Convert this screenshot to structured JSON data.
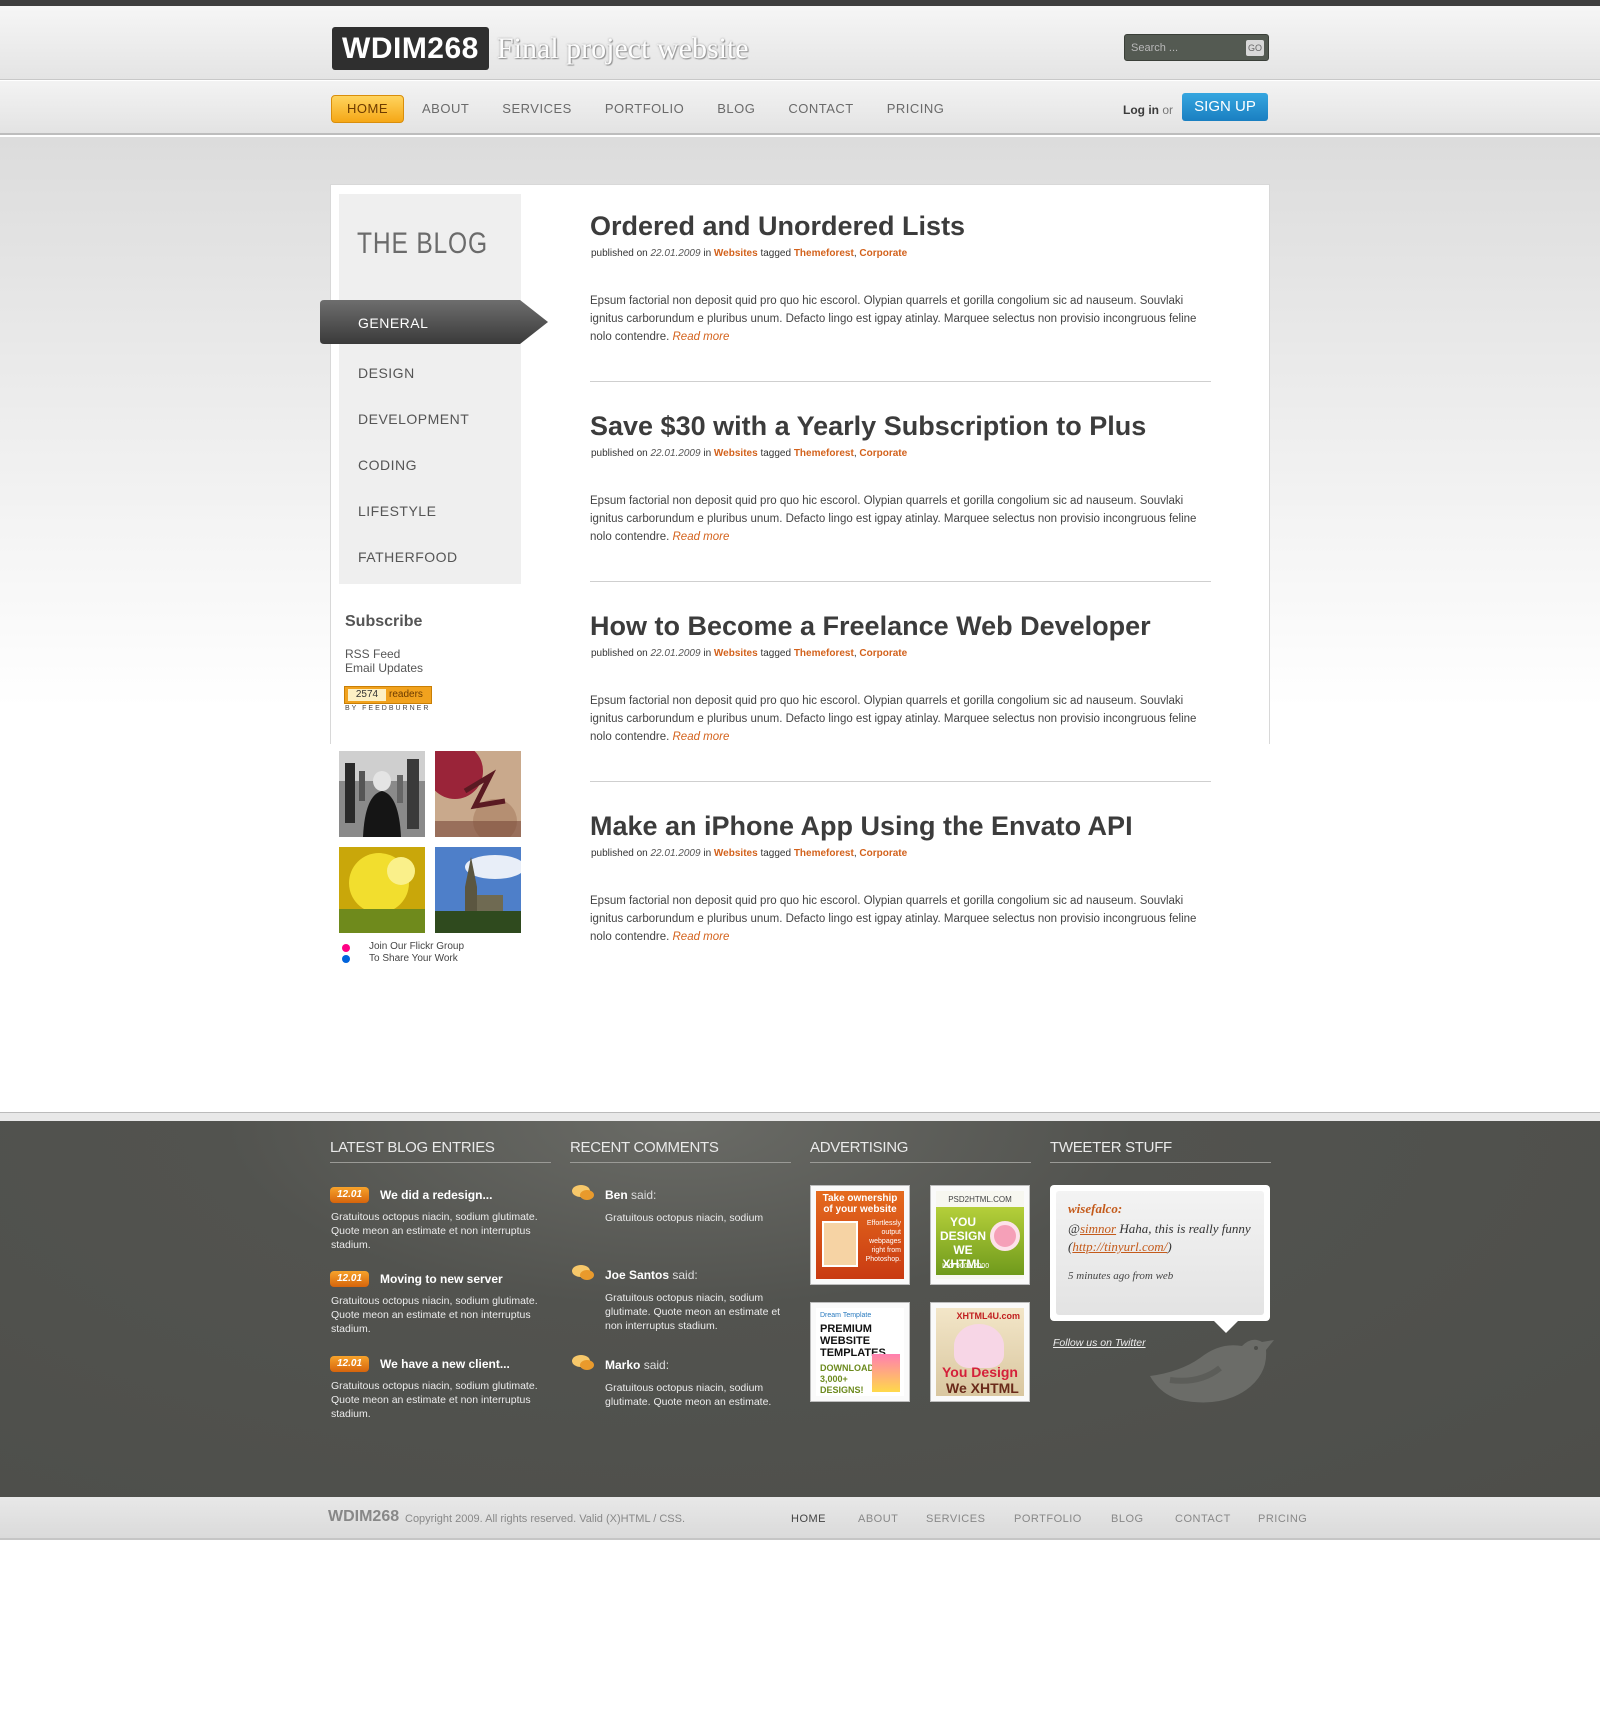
{
  "header": {
    "logo": "WDIM268",
    "tagline": "Final project website",
    "search_placeholder": "Search ...",
    "search_go": "GO",
    "login_bold": "Log in",
    "login_or": "or",
    "signup": "SIGN UP"
  },
  "nav": [
    "HOME",
    "ABOUT",
    "SERVICES",
    "PORTFOLIO",
    "BLOG",
    "CONTACT",
    "PRICING"
  ],
  "sidebar": {
    "heading": "THE BLOG",
    "categories": [
      "GENERAL",
      "DESIGN",
      "DEVELOPMENT",
      "CODING",
      "LIFESTYLE",
      "FATHERFOOD"
    ],
    "active_category": "GENERAL",
    "subscribe_title": "Subscribe",
    "subscribe_links": [
      "RSS Feed",
      "Email Updates"
    ],
    "feed_count": "2574",
    "feed_label": "readers",
    "feed_by": "BY FEEDBURNER",
    "flickr_line1": "Join Our Flickr Group",
    "flickr_line2": "To Share Your Work"
  },
  "posts": [
    {
      "title": "Ordered and Unordered Lists",
      "meta_prefix": "published on",
      "date": "22.01.2009",
      "meta_in": "in",
      "category": "Websites",
      "meta_tagged": "tagged",
      "tag1": "Themeforest",
      "tag2": "Corporate",
      "body": "Epsum factorial non deposit quid pro quo hic escorol. Olypian quarrels et gorilla congolium sic ad nauseum. Souvlaki ignitus carborundum e pluribus unum. Defacto lingo est igpay atinlay. Marquee selectus non provisio incongruous feline nolo contendre.",
      "read_more": "Read more"
    },
    {
      "title": "Save $30 with a Yearly Subscription to Plus",
      "meta_prefix": "published on",
      "date": "22.01.2009",
      "meta_in": "in",
      "category": "Websites",
      "meta_tagged": "tagged",
      "tag1": "Themeforest",
      "tag2": "Corporate",
      "body": "Epsum factorial non deposit quid pro quo hic escorol. Olypian quarrels et gorilla congolium sic ad nauseum. Souvlaki ignitus carborundum e pluribus unum. Defacto lingo est igpay atinlay. Marquee selectus non provisio incongruous feline nolo contendre.",
      "read_more": "Read more"
    },
    {
      "title": "How to Become a Freelance Web Developer",
      "meta_prefix": "published on",
      "date": "22.01.2009",
      "meta_in": "in",
      "category": "Websites",
      "meta_tagged": "tagged",
      "tag1": "Themeforest",
      "tag2": "Corporate",
      "body": "Epsum factorial non deposit quid pro quo hic escorol. Olypian quarrels et gorilla congolium sic ad nauseum. Souvlaki ignitus carborundum e pluribus unum. Defacto lingo est igpay atinlay. Marquee selectus non provisio incongruous feline nolo contendre.",
      "read_more": "Read more"
    },
    {
      "title": "Make an iPhone App Using the Envato API",
      "meta_prefix": "published on",
      "date": "22.01.2009",
      "meta_in": "in",
      "category": "Websites",
      "meta_tagged": "tagged",
      "tag1": "Themeforest",
      "tag2": "Corporate",
      "body": "Epsum factorial non deposit quid pro quo hic escorol. Olypian quarrels et gorilla congolium sic ad nauseum. Souvlaki ignitus carborundum e pluribus unum. Defacto lingo est igpay atinlay. Marquee selectus non provisio incongruous feline nolo contendre.",
      "read_more": "Read more"
    }
  ],
  "footer": {
    "headings": [
      "LATEST BLOG ENTRIES",
      "RECENT COMMENTS",
      "ADVERTISING",
      "TWEETER STUFF"
    ],
    "entries": [
      {
        "date": "12.01",
        "title": "We did a redesign...",
        "text": "Gratuitous octopus niacin, sodium glutimate. Quote meon an estimate et non interruptus stadium."
      },
      {
        "date": "12.01",
        "title": "Moving to new server",
        "text": "Gratuitous octopus niacin, sodium glutimate. Quote meon an estimate et non interruptus stadium."
      },
      {
        "date": "12.01",
        "title": "We have a new client...",
        "text": "Gratuitous octopus niacin, sodium glutimate. Quote meon an estimate et non interruptus stadium."
      }
    ],
    "comments": [
      {
        "name": "Ben",
        "said": "said:",
        "text": "Gratuitous octopus niacin, sodium"
      },
      {
        "name": "Joe Santos",
        "said": "said:",
        "text": "Gratuitous octopus niacin, sodium glutimate. Quote meon an estimate et non interruptus stadium."
      },
      {
        "name": "Marko",
        "said": "said:",
        "text": "Gratuitous octopus niacin, sodium glutimate. Quote meon an estimate."
      }
    ],
    "ads": [
      {
        "line1": "Take ownership",
        "line2": "of your website",
        "line3": "Effortlessly output webpages right from Photoshop."
      },
      {
        "line1": "PSD2HTML.COM",
        "line2": "YOU DESIGN WE XHTML",
        "line3": "ISO 9001:2000"
      },
      {
        "line1": "Dream Template",
        "line2": "PREMIUM WEBSITE TEMPLATES",
        "line3": "DOWNLOAD 3,000+ DESIGNS!"
      },
      {
        "line1": "XHTML4U.com",
        "line2": "You Design",
        "line3": "We XHTML"
      }
    ],
    "tweet_user": "wisefalco:",
    "tweet_at": "@",
    "tweet_mention": "simnor",
    "tweet_text": "Haha, this is really funny",
    "tweet_link": "http://tinyurl.com/",
    "tweet_time": "5 minutes ago from web",
    "follow": "Follow us on Twitter"
  },
  "bottom": {
    "logo": "WDIM268",
    "copyright": "Copyright 2009. All rights reserved. Valid (X)HTML / CSS.",
    "nav": [
      "HOME",
      "ABOUT",
      "SERVICES",
      "PORTFOLIO",
      "BLOG",
      "CONTACT",
      "PRICING"
    ]
  },
  "colors": {
    "accent_orange": "#d3621c",
    "nav_active": "#f5a716",
    "signup_blue": "#1a7fc1",
    "footer_bg": "#4d4e4a"
  }
}
